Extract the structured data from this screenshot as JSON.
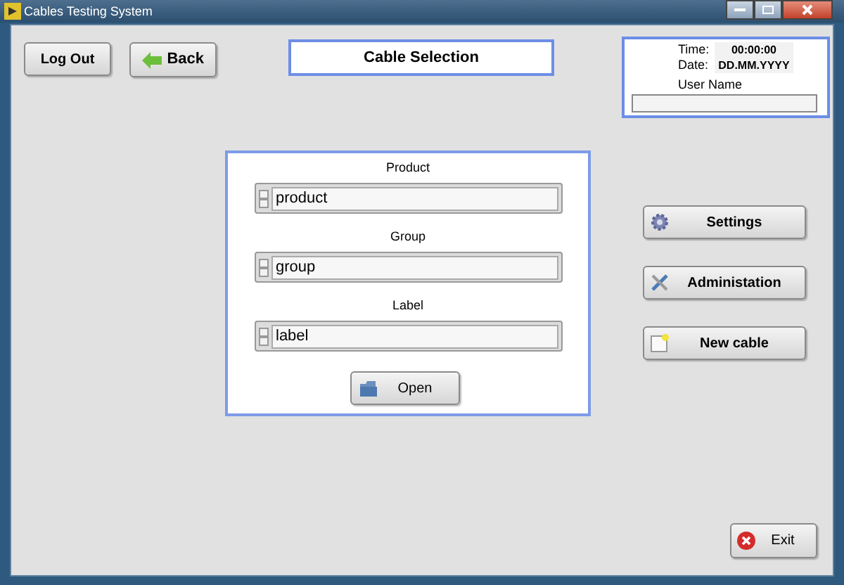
{
  "window": {
    "title": "Cables Testing System"
  },
  "top_buttons": [
    {
      "label": "Log Out",
      "kind": "plain"
    },
    {
      "label": "Back",
      "kind": "back"
    }
  ],
  "heading": "Cable Selection",
  "info": {
    "time_label": "Time:",
    "time": "00:00:00",
    "date_label": "Date:",
    "date": "DD.MM.YYYY",
    "user_label": "User Name"
  },
  "selectors": [
    {
      "label": "Product",
      "value": "product"
    },
    {
      "label": "Group",
      "value": "group"
    },
    {
      "label": "Label",
      "value": "label"
    }
  ],
  "open_button": "Open",
  "side_buttons": [
    {
      "label": "Settings",
      "kind": "settings"
    },
    {
      "label": "Administation",
      "kind": "admin"
    },
    {
      "label": "New cable",
      "kind": "new"
    }
  ],
  "exit_button": "Exit"
}
